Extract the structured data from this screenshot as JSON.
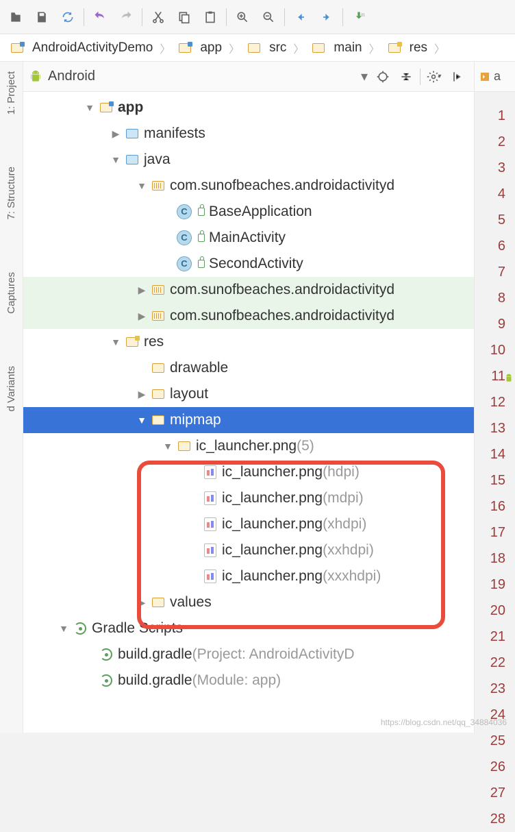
{
  "toolbar_icons": [
    "open",
    "save",
    "sync",
    "undo",
    "redo",
    "cut",
    "copy",
    "paste",
    "zoom-in",
    "zoom-out",
    "back",
    "forward",
    "download"
  ],
  "breadcrumb": [
    {
      "label": "AndroidActivityDemo",
      "type": "module"
    },
    {
      "label": "app",
      "type": "module"
    },
    {
      "label": "src",
      "type": "folder"
    },
    {
      "label": "main",
      "type": "folder"
    },
    {
      "label": "res",
      "type": "res"
    }
  ],
  "side_tabs": [
    "1: Project",
    "7: Structure",
    "Captures",
    "d Variants"
  ],
  "panel_selector": "Android",
  "editor_tab": "a",
  "tree": [
    {
      "indent": 0,
      "arrow": "down",
      "icon": "module",
      "label": "app",
      "bold": true
    },
    {
      "indent": 1,
      "arrow": "right",
      "icon": "folder-blue",
      "label": "manifests"
    },
    {
      "indent": 1,
      "arrow": "down",
      "icon": "folder-blue",
      "label": "java"
    },
    {
      "indent": 2,
      "arrow": "down",
      "icon": "package",
      "label": "com.sunofbeaches.androidactivityd"
    },
    {
      "indent": 3,
      "arrow": "",
      "icon": "class",
      "label": "BaseApplication",
      "lock": true
    },
    {
      "indent": 3,
      "arrow": "",
      "icon": "class",
      "label": "MainActivity",
      "lock": true
    },
    {
      "indent": 3,
      "arrow": "",
      "icon": "class",
      "label": "SecondActivity",
      "lock": true
    },
    {
      "indent": 2,
      "arrow": "right",
      "icon": "package",
      "label": "com.sunofbeaches.androidactivityd",
      "hl": true
    },
    {
      "indent": 2,
      "arrow": "right",
      "icon": "package",
      "label": "com.sunofbeaches.androidactivityd",
      "hl": true
    },
    {
      "indent": 1,
      "arrow": "down",
      "icon": "res",
      "label": "res"
    },
    {
      "indent": 2,
      "arrow": "",
      "icon": "folder-open",
      "label": "drawable"
    },
    {
      "indent": 2,
      "arrow": "right",
      "icon": "folder-open",
      "label": "layout"
    },
    {
      "indent": 2,
      "arrow": "down",
      "icon": "folder-open",
      "label": "mipmap",
      "selected": true
    },
    {
      "indent": 3,
      "arrow": "down",
      "icon": "folder-open",
      "label": "ic_launcher.png",
      "suffix": "(5)"
    },
    {
      "indent": 4,
      "arrow": "",
      "icon": "img",
      "label": "ic_launcher.png",
      "suffix": "(hdpi)"
    },
    {
      "indent": 4,
      "arrow": "",
      "icon": "img",
      "label": "ic_launcher.png",
      "suffix": "(mdpi)"
    },
    {
      "indent": 4,
      "arrow": "",
      "icon": "img",
      "label": "ic_launcher.png",
      "suffix": "(xhdpi)"
    },
    {
      "indent": 4,
      "arrow": "",
      "icon": "img",
      "label": "ic_launcher.png",
      "suffix": "(xxhdpi)"
    },
    {
      "indent": 4,
      "arrow": "",
      "icon": "img",
      "label": "ic_launcher.png",
      "suffix": "(xxxhdpi)"
    },
    {
      "indent": 2,
      "arrow": "right",
      "icon": "folder-open",
      "label": "values"
    },
    {
      "indent": -1,
      "arrow": "down",
      "icon": "gradle",
      "label": "Gradle Scripts"
    },
    {
      "indent": 0,
      "arrow": "",
      "icon": "gradle",
      "label": "build.gradle",
      "suffix": "(Project: AndroidActivityD"
    },
    {
      "indent": 0,
      "arrow": "",
      "icon": "gradle",
      "label": "build.gradle",
      "suffix": "(Module: app)"
    }
  ],
  "line_start": 1,
  "line_end": 28,
  "gutter_marks": [
    {
      "line": 11,
      "type": "android"
    }
  ],
  "watermark": "https://blog.csdn.net/qq_34884036"
}
